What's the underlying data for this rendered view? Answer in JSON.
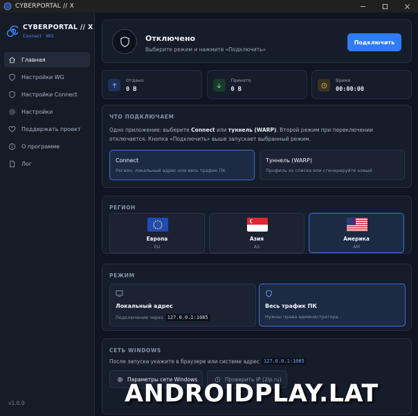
{
  "window": {
    "title": "CYBERPORTAL // X"
  },
  "brand": {
    "name": "CYBERPORTAL // X",
    "tagline": "Connect · WG"
  },
  "sidebar": {
    "items": [
      {
        "label": "Главная",
        "icon": "home-icon",
        "active": true
      },
      {
        "label": "Настройки WG",
        "icon": "shield-icon",
        "active": false
      },
      {
        "label": "Настройки Connect",
        "icon": "shield-icon",
        "active": false
      },
      {
        "label": "Настройки",
        "icon": "gear-icon",
        "active": false
      },
      {
        "label": "Поддержать проект",
        "icon": "heart-icon",
        "active": false
      },
      {
        "label": "О программе",
        "icon": "info-icon",
        "active": false
      },
      {
        "label": "Лог",
        "icon": "document-icon",
        "active": false
      }
    ],
    "version": "v1.0.0"
  },
  "status": {
    "title": "Отключено",
    "subtitle": "Выберите режим и нажмите «Подключить»",
    "button": "Подключить"
  },
  "stats": [
    {
      "label": "Отдано",
      "value": "0 B"
    },
    {
      "label": "Принято",
      "value": "0 B"
    },
    {
      "label": "Время",
      "value": "00:00:00"
    }
  ],
  "what": {
    "title": "ЧТО ПОДКЛЮЧАЕМ",
    "desc_1": "Одно приложение: выберите ",
    "desc_b1": "Connect",
    "desc_2": " или ",
    "desc_b2": "туннель (WARP)",
    "desc_3": ". Второй режим при переключении отключается. Кнопка «Подключить» выше запускает выбранный режим.",
    "options": [
      {
        "title": "Connect",
        "subtitle": "Регион, локальный адрес или весь трафик ПК",
        "selected": true
      },
      {
        "title": "Туннель (WARP)",
        "subtitle": "Профиль из списка или сгенерируйте новый",
        "selected": false
      }
    ]
  },
  "region": {
    "title": "РЕГИОН",
    "items": [
      {
        "name": "Европа",
        "code": "EU",
        "selected": false
      },
      {
        "name": "Азия",
        "code": "AS",
        "selected": false
      },
      {
        "name": "Америка",
        "code": "AM",
        "selected": true
      }
    ]
  },
  "mode": {
    "title": "РЕЖИМ",
    "items": [
      {
        "title": "Локальный адрес",
        "subtitle": "Подключение через",
        "address": "127.0.0.1:1085",
        "icon": "monitor-icon",
        "selected": false
      },
      {
        "title": "Весь трафик ПК",
        "subtitle": "Нужны права администратора",
        "icon": "shield-icon",
        "selected": true
      }
    ]
  },
  "windows_net": {
    "title": "СЕТЬ WINDOWS",
    "desc": "После запуска укажите в браузере или системе адрес",
    "address": "127.0.0.1:1085",
    "btn_settings": "Параметры сети Windows",
    "btn_check": "Проверить IP (2ip.ru)"
  },
  "watermark": "ANDROIDPLAY.LAT",
  "colors": {
    "accent": "#2f7cf6",
    "background": "#0f1521",
    "card": "#151c2a",
    "selected_border": "#3d73d6"
  }
}
